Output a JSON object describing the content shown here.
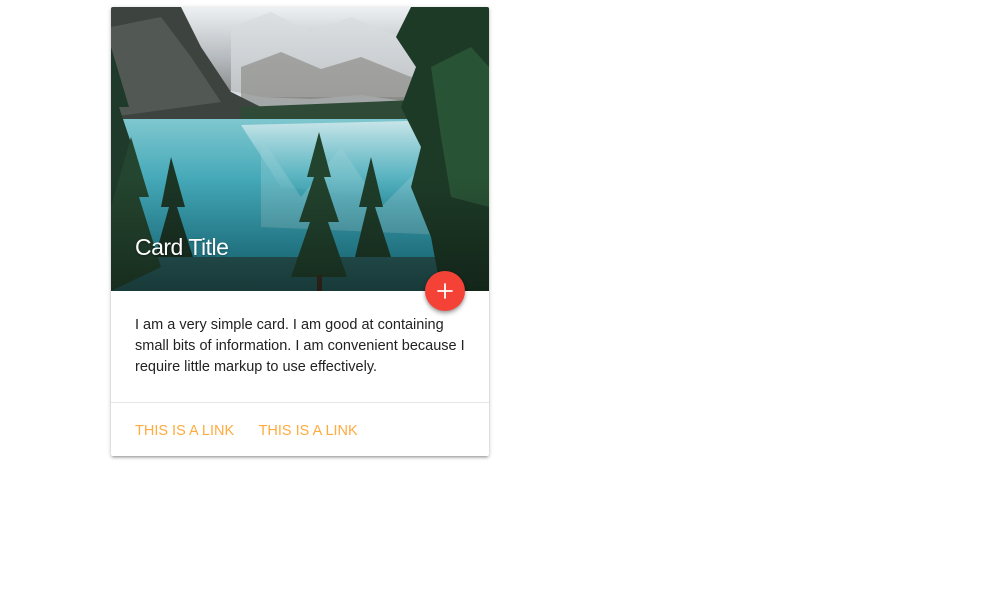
{
  "card": {
    "image": {
      "description_icon": "mountain-lake-photo"
    },
    "title": "Card Title",
    "fab": {
      "icon": "plus-icon",
      "color": "#f44336"
    },
    "content": "I am a very simple card. I am good at containing small bits of information. I am convenient because I require little markup to use effectively.",
    "links": [
      {
        "label": "THIS IS A LINK"
      },
      {
        "label": "THIS IS A LINK"
      }
    ],
    "link_color": "#ffab40"
  }
}
